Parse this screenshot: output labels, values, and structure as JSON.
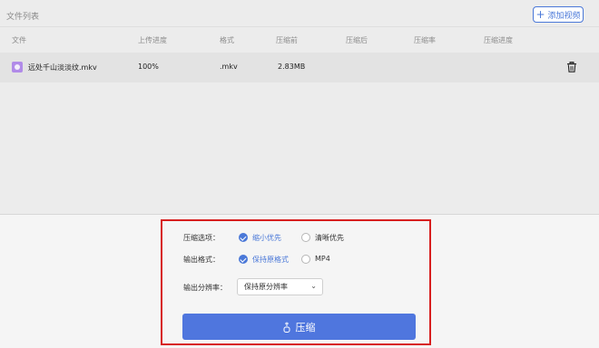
{
  "file_list": {
    "title": "文件列表",
    "add_video_label": "添加视频",
    "columns": [
      "文件",
      "上传进度",
      "格式",
      "压缩前",
      "压缩后",
      "压缩率",
      "压缩进度"
    ],
    "rows": [
      {
        "name": "远处千山淡淡纹.mkv",
        "upload_progress": "100%",
        "format": ".mkv",
        "size_before": "2.83MB",
        "size_after": "",
        "ratio": "",
        "compress_progress": ""
      }
    ]
  },
  "options": {
    "compress_option_label": "压缩选项：",
    "compress_choices": [
      "缩小优先",
      "清晰优先"
    ],
    "compress_selected": "缩小优先",
    "output_format_label": "输出格式：",
    "format_choices": [
      "保持原格式",
      "MP4"
    ],
    "format_selected": "保持原格式",
    "resolution_label": "输出分辨率：",
    "resolution_value": "保持原分辨率",
    "compress_button": "压缩"
  },
  "colors": {
    "accent": "#4a78d8",
    "highlight": "#d71f1f"
  },
  "icons": {
    "add": "plus-icon",
    "file": "video-file-icon",
    "delete": "trash-icon",
    "chevron": "chevron-down-icon",
    "compress": "compress-icon"
  }
}
